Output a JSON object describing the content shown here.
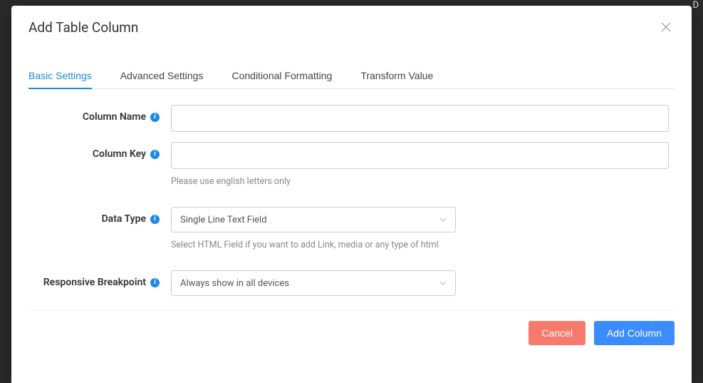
{
  "header": {
    "title": "Add Table Column"
  },
  "tabs": {
    "basic": "Basic Settings",
    "advanced": "Advanced Settings",
    "conditional": "Conditional Formatting",
    "transform": "Transform Value"
  },
  "fields": {
    "column_name": {
      "label": "Column Name",
      "value": ""
    },
    "column_key": {
      "label": "Column Key",
      "value": "",
      "help": "Please use english letters only"
    },
    "data_type": {
      "label": "Data Type",
      "selected": "Single Line Text Field",
      "help": "Select HTML Field if you want to add Link, media or any type of html"
    },
    "responsive_breakpoint": {
      "label": "Responsive Breakpoint",
      "selected": "Always show in all devices"
    }
  },
  "footer": {
    "cancel": "Cancel",
    "add_column": "Add Column"
  },
  "icons": {
    "info_glyph": "i"
  },
  "background_hint": "D"
}
